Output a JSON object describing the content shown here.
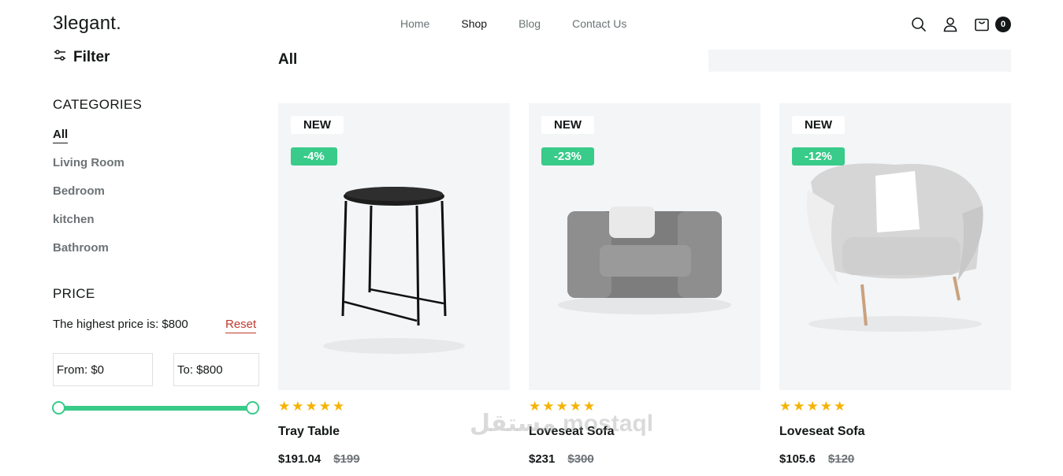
{
  "header": {
    "logo": "3legant.",
    "nav": [
      "Home",
      "Shop",
      "Blog",
      "Contact Us"
    ],
    "active_nav": "Shop",
    "cart_count": "0"
  },
  "sidebar": {
    "filter_label": "Filter",
    "categories_title": "CATEGORIES",
    "categories": [
      "All",
      "Living Room",
      "Bedroom",
      "kitchen",
      "Bathroom"
    ],
    "active_category": "All",
    "price_title": "PRICE",
    "price_note": "The highest price is: $800",
    "reset_label": "Reset",
    "from_value": "From: $0",
    "to_value": "To: $800",
    "slider_min_fraction": 0,
    "slider_max_fraction": 1
  },
  "main": {
    "title": "All",
    "products": [
      {
        "badge": "NEW",
        "discount": "-4%",
        "rating": 5,
        "name": "Tray Table",
        "price": "$191.04",
        "old_price": "$199"
      },
      {
        "badge": "NEW",
        "discount": "-23%",
        "rating": 5,
        "name": "Loveseat Sofa",
        "price": "$231",
        "old_price": "$300"
      },
      {
        "badge": "NEW",
        "discount": "-12%",
        "rating": 5,
        "name": "Loveseat Sofa",
        "price": "$105.6",
        "old_price": "$120"
      }
    ]
  },
  "watermark": "مستقل mostaql",
  "colors": {
    "accent_green": "#38cb89",
    "star": "#f5b301",
    "reset_red": "#c0392b",
    "card_bg": "#f3f5f7"
  }
}
